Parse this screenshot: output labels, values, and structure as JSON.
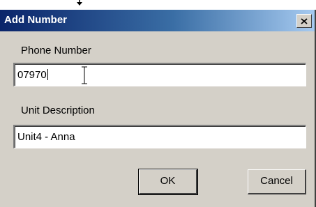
{
  "dialog": {
    "title": "Add Number",
    "close_icon": "close-x-icon"
  },
  "phone": {
    "label": "Phone Number",
    "value": "07970"
  },
  "unit": {
    "label": "Unit Description",
    "value": "Unit4 - Anna"
  },
  "buttons": {
    "ok": "OK",
    "cancel": "Cancel"
  },
  "colors": {
    "title_start": "#0a246a",
    "title_end": "#a6caf0",
    "face": "#d4d0c8"
  }
}
